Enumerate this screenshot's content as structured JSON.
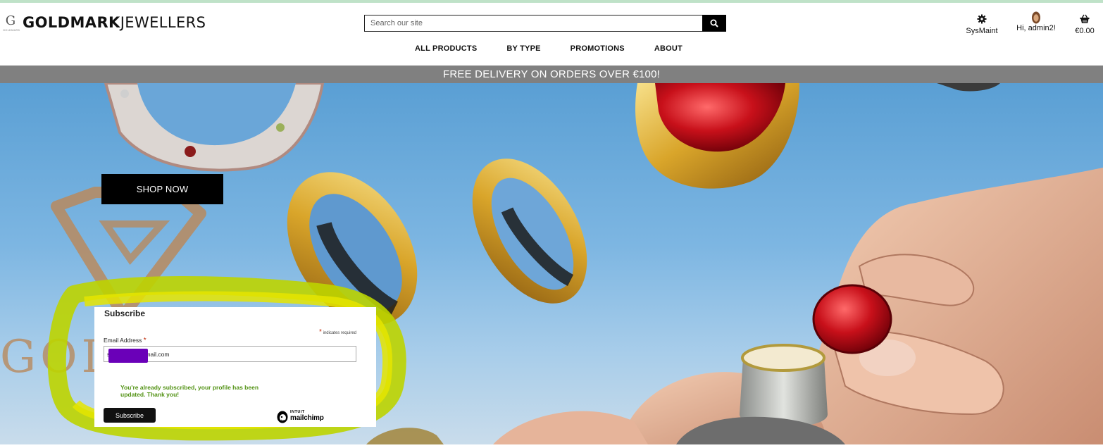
{
  "brand": {
    "logo_letter": "G",
    "logo_small": "GOLDMARK",
    "name_bold": "GOLDMARK",
    "name_light": "JEWELLERS"
  },
  "search": {
    "placeholder": "Search our site"
  },
  "nav": {
    "items": [
      {
        "label": "ALL PRODUCTS"
      },
      {
        "label": "BY TYPE"
      },
      {
        "label": "PROMOTIONS"
      },
      {
        "label": "ABOUT"
      }
    ]
  },
  "header_right": {
    "sysmaint_label": "SysMaint",
    "account_label": "Hi, admin2!",
    "cart_total": "€0.00"
  },
  "banner": {
    "text": "FREE DELIVERY ON ORDERS OVER €100!"
  },
  "hero": {
    "shop_button": "SHOP NOW",
    "watermark_text": "GOL"
  },
  "subscribe": {
    "title": "Subscribe",
    "required_note": "indicates required",
    "email_label": "Email Address",
    "email_value": "seyex1232@gmail.com",
    "success_message": "You're already subscribed, your profile has been updated. Thank you!",
    "button_label": "Subscribe",
    "badge_top": "INTUIT",
    "badge_bottom": "mailchimp"
  },
  "colors": {
    "banner_bg": "#808080",
    "success_green": "#529214",
    "highlight_yellow": "#e5e500",
    "redaction_purple": "#6a00b8"
  }
}
